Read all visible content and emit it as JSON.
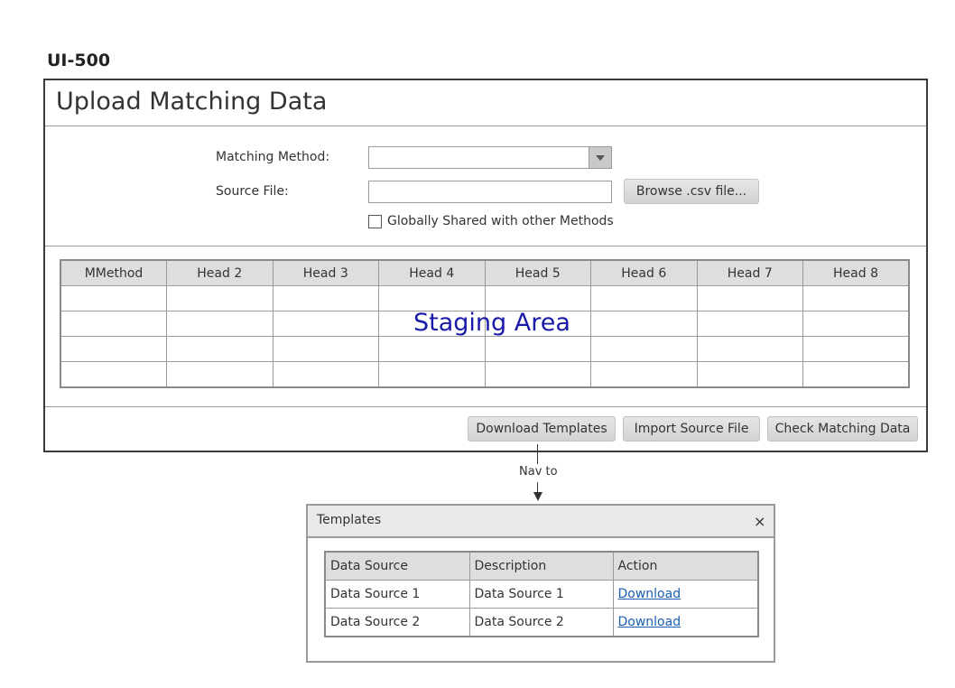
{
  "screen_id": "UI-500",
  "page_title": "Upload Matching Data",
  "form": {
    "matching_method_label": "Matching Method:",
    "matching_method_value": "",
    "source_file_label": "Source File:",
    "source_file_value": "",
    "browse_button_label": "Browse .csv file...",
    "shared_checkbox_label": "Globally Shared with other Methods",
    "shared_checkbox_checked": false
  },
  "staging": {
    "columns": [
      "MMethod",
      "Head 2",
      "Head 3",
      "Head 4",
      "Head 5",
      "Head 6",
      "Head 7",
      "Head 8"
    ],
    "overlay_label": "Staging Area"
  },
  "actions": {
    "download_templates": "Download Templates",
    "import_source": "Import Source File",
    "check_matching": "Check Matching Data"
  },
  "nav": {
    "label": "Nav to"
  },
  "templates_dialog": {
    "title": "Templates",
    "close_glyph": "×",
    "columns": [
      "Data Source",
      "Description",
      "Action"
    ],
    "rows": [
      {
        "data_source": "Data Source 1",
        "description": "Data Source 1",
        "action": "Download"
      },
      {
        "data_source": "Data Source 2",
        "description": "Data Source 2",
        "action": "Download"
      }
    ]
  }
}
